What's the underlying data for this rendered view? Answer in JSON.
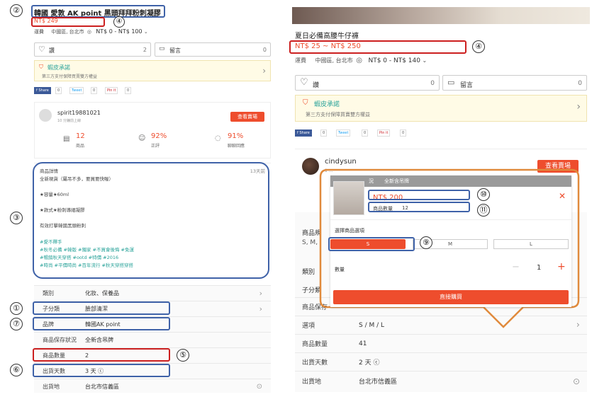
{
  "left": {
    "title": "韓國 愛敦 AK point 黑頭拜拜粉刺凝膠",
    "price": "NT$ 249",
    "shipping_label": "運費",
    "ship_location": "中國區, 台北市",
    "ship_fee": "NT$ 0 - NT$ 100",
    "like_label": "讚",
    "like_count": "2",
    "comment_label": "留言",
    "comment_count": "0",
    "guarantee_title": "蝦皮承諾",
    "guarantee_sub": "第三方支付保障買賣雙方權益",
    "share": [
      "f Share",
      "0",
      "Tweet",
      "0",
      "Pin it",
      "0"
    ],
    "seller": {
      "name": "spirit19881021",
      "sub": "10 分鐘前上線",
      "button": "查看賣場",
      "stat1_value": "12",
      "stat1_label": "商品",
      "stat2_value": "92%",
      "stat2_label": "正評",
      "stat3_value": "91%",
      "stat3_label": "聊聊回應"
    },
    "desc": {
      "header": "商品詳情",
      "days": "13天前",
      "lines": [
        "全新現貨（屬吊不多，要買要快喔）",
        "",
        "★容量★60ml",
        "",
        "★款式★粉刺導細凝膠",
        "",
        "有效打擊韓國黑頭粉刺",
        "",
        ""
      ],
      "tags": [
        "#愛不釋手",
        "#秋冬必備 #韓版 #獨家 #不買會後悔 #免運",
        "#暢銷秋天穿搭 #ootd #特價 #2016",
        "#時尚 #平價時尚 #百年流行 #秋天穿搭穿搭"
      ]
    },
    "rows": [
      {
        "k": "類別",
        "v": "化妝、保養品",
        "chev": "›"
      },
      {
        "k": "子分類",
        "v": "臉部清潔",
        "chev": "›"
      },
      {
        "k": "品牌",
        "v": "韓國AK point",
        "chev": ""
      },
      {
        "k": "商品保存狀況",
        "v": "全新含吊牌",
        "chev": ""
      },
      {
        "k": "商品數量",
        "v": "2",
        "chev": ""
      },
      {
        "k": "出貨天數",
        "v": "3 天 ⓒ",
        "chev": ""
      },
      {
        "k": "出貨地",
        "v": "台北市信義區",
        "chev": "⊙"
      }
    ]
  },
  "right": {
    "title": "夏日必備高腰牛仔褲",
    "price": "NT$ 25 ~ NT$ 250",
    "shipping_label": "運費",
    "ship_location": "中國區, 台北市",
    "ship_fee": "NT$ 0 - NT$ 140",
    "like_label": "讚",
    "like_count": "0",
    "comment_label": "留言",
    "comment_count": "0",
    "guarantee_title": "蝦皮承諾",
    "guarantee_sub": "第三方支付保障買賣雙方權益",
    "share": [
      "f Share",
      "0",
      "Tweet",
      "0",
      "Pin it",
      "0"
    ],
    "seller_name": "cindysun",
    "seller_sub": "1 ...",
    "seller_button": "查看賣場",
    "partial_labels": {
      "spec": "商品規",
      "spec_v": "S, M,",
      "cat": "類別",
      "sub": "子分類",
      "keep": "商品保存"
    },
    "rows": [
      {
        "k": "選項",
        "v": "S / M / L",
        "chev": "›"
      },
      {
        "k": "商品數量",
        "v": "41",
        "chev": ""
      },
      {
        "k": "出貨天數",
        "v": "2 天 ⓒ",
        "chev": ""
      },
      {
        "k": "出貨地",
        "v": "台北市信義區",
        "chev": "⊙"
      }
    ],
    "popup": {
      "header_tag": "況",
      "header_cond": "全新含吊牌",
      "price": "NT$ 200",
      "qty_label": "商品數量",
      "qty_value": "12",
      "close": "✕",
      "option_title": "選擇商品選項",
      "options": [
        "S",
        "M",
        "L"
      ],
      "amount_label": "數量",
      "amount_value": "1",
      "minus": "−",
      "plus": "+",
      "buy_button": "直接購買"
    }
  },
  "markers": {
    "m1": "①",
    "m2": "②",
    "m3": "③",
    "m4": "④",
    "m4b": "④",
    "m5": "⑤",
    "m6": "⑥",
    "m7": "⑦",
    "m9": "⑨",
    "m10": "⑩",
    "m11": "⑪"
  },
  "colors": {
    "accent": "#ee4d2d",
    "annot_blue": "#3f62a8",
    "annot_red": "#cc1f1f",
    "tag_green": "#2aa39a",
    "popup_border": "#e08a3c"
  }
}
